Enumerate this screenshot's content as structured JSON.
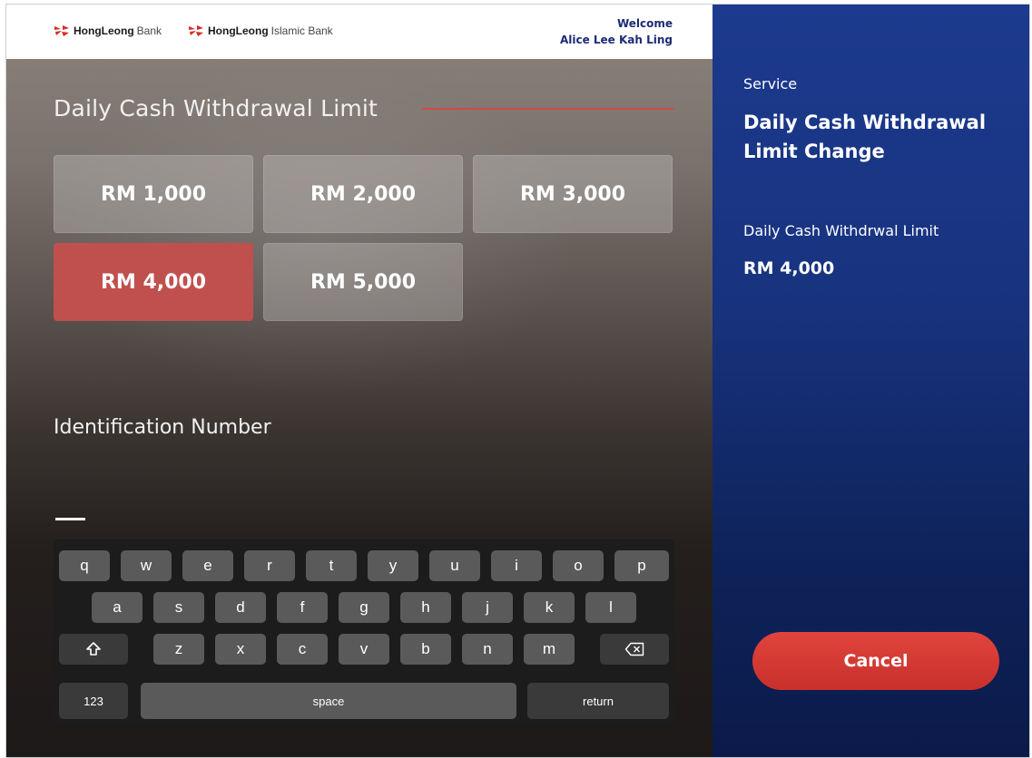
{
  "header": {
    "logos": [
      {
        "brand": "HongLeong",
        "suffix": "Bank"
      },
      {
        "brand": "HongLeong",
        "suffix": "Islamic Bank"
      }
    ],
    "welcome_label": "Welcome",
    "user_name": "Alice Lee Kah Ling"
  },
  "main": {
    "title": "Daily Cash Withdrawal Limit",
    "limit_options": [
      "RM 1,000",
      "RM 2,000",
      "RM 3,000",
      "RM 4,000",
      "RM 5,000"
    ],
    "selected_option": "RM 4,000",
    "id_label": "Identification Number",
    "id_value": ""
  },
  "keyboard": {
    "row1": [
      "q",
      "w",
      "e",
      "r",
      "t",
      "y",
      "u",
      "i",
      "o",
      "p"
    ],
    "row2": [
      "a",
      "s",
      "d",
      "f",
      "g",
      "h",
      "j",
      "k",
      "l"
    ],
    "row3": [
      "z",
      "x",
      "c",
      "v",
      "b",
      "n",
      "m"
    ],
    "shift_icon": "shift-arrow-icon",
    "backspace_icon": "backspace-icon",
    "numbers_label": "123",
    "space_label": "space",
    "return_label": "return"
  },
  "sidebar": {
    "service_label": "Service",
    "service_value": "Daily Cash Withdrawal Limit Change",
    "limit_label": "Daily Cash Withdrwal Limit",
    "limit_value": "RM 4,000",
    "cancel_label": "Cancel"
  },
  "colors": {
    "accent_red": "#c0504d",
    "panel_blue": "#1c3a8e",
    "cancel_red": "#d93a35",
    "welcome_blue": "#1b2c74"
  }
}
